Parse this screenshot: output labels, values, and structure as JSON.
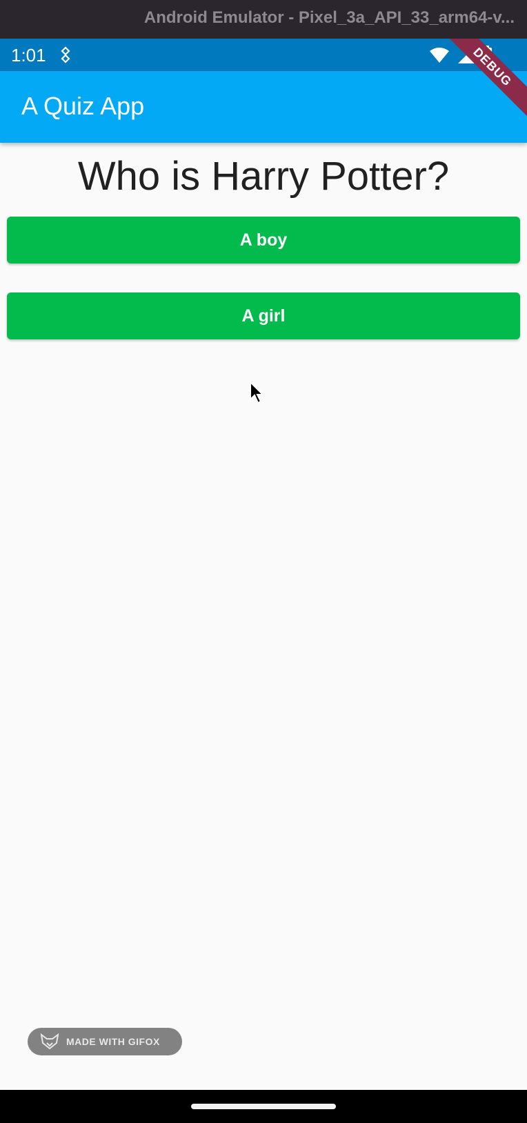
{
  "window": {
    "title": "Android Emulator - Pixel_3a_API_33_arm64-v..."
  },
  "status_bar": {
    "time": "1:01",
    "icons": [
      "notification-icon",
      "wifi-icon",
      "signal-icon",
      "battery-icon"
    ]
  },
  "app_bar": {
    "title": "A Quiz App",
    "color": "#03a9f4"
  },
  "debug_banner": {
    "label": "DEBUG"
  },
  "quiz": {
    "question": "Who is Harry Potter?",
    "answers": [
      {
        "label": "A boy"
      },
      {
        "label": "A girl"
      }
    ],
    "button_color": "#02bb4c"
  },
  "watermark": {
    "label": "MADE WITH GIFOX"
  }
}
